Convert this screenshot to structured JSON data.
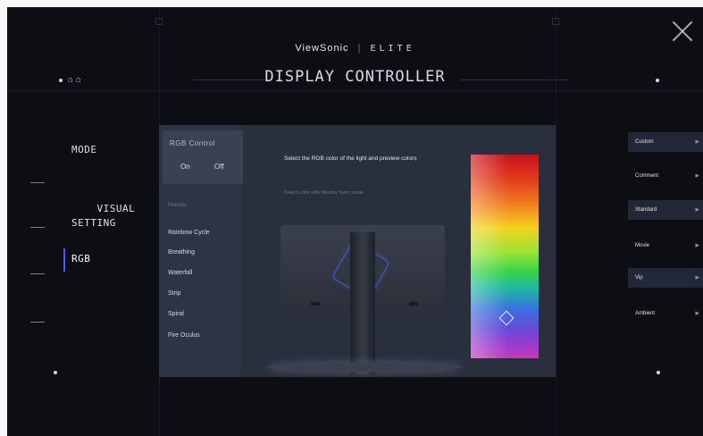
{
  "header": {
    "brand": "ViewSonic",
    "separator": "|",
    "sub_brand": "ELITE",
    "title": "DISPLAY CONTROLLER"
  },
  "top_left": {
    "icons": [
      "dot",
      "settings-icon",
      "monitor-icon"
    ],
    "label": "⌂ ⌂"
  },
  "nav": {
    "items": [
      {
        "label": "MODE"
      },
      {
        "label": "VISUAL\nSETTING"
      },
      {
        "label": "RGB"
      }
    ],
    "active": "RGB"
  },
  "rgb_panel": {
    "title": "RGB Control",
    "toggle_on": "On",
    "toggle_off": "Off",
    "preset_heading": "Presets",
    "presets": [
      "Rainbow Cycle",
      "Breathing",
      "Waterfall",
      "Strip",
      "Spiral",
      "Fire Oculus"
    ],
    "description": "Select the RGB color of the light and preview colors",
    "description_sub": "Select color with Monitor Sync mode"
  },
  "right_list": {
    "items": [
      {
        "label": "Custom",
        "arrow": "▸"
      },
      {
        "label": "Comment",
        "arrow": "▸"
      },
      {
        "label": "Standard",
        "arrow": "▸"
      },
      {
        "label": "Movie",
        "arrow": "▸"
      },
      {
        "label": "Vip",
        "arrow": "▸"
      },
      {
        "label": "Ambient",
        "arrow": "▸"
      }
    ]
  },
  "colors": {
    "background": "#0c0e14",
    "panel": "#2a2f3e",
    "accent": "#4d57ff"
  }
}
